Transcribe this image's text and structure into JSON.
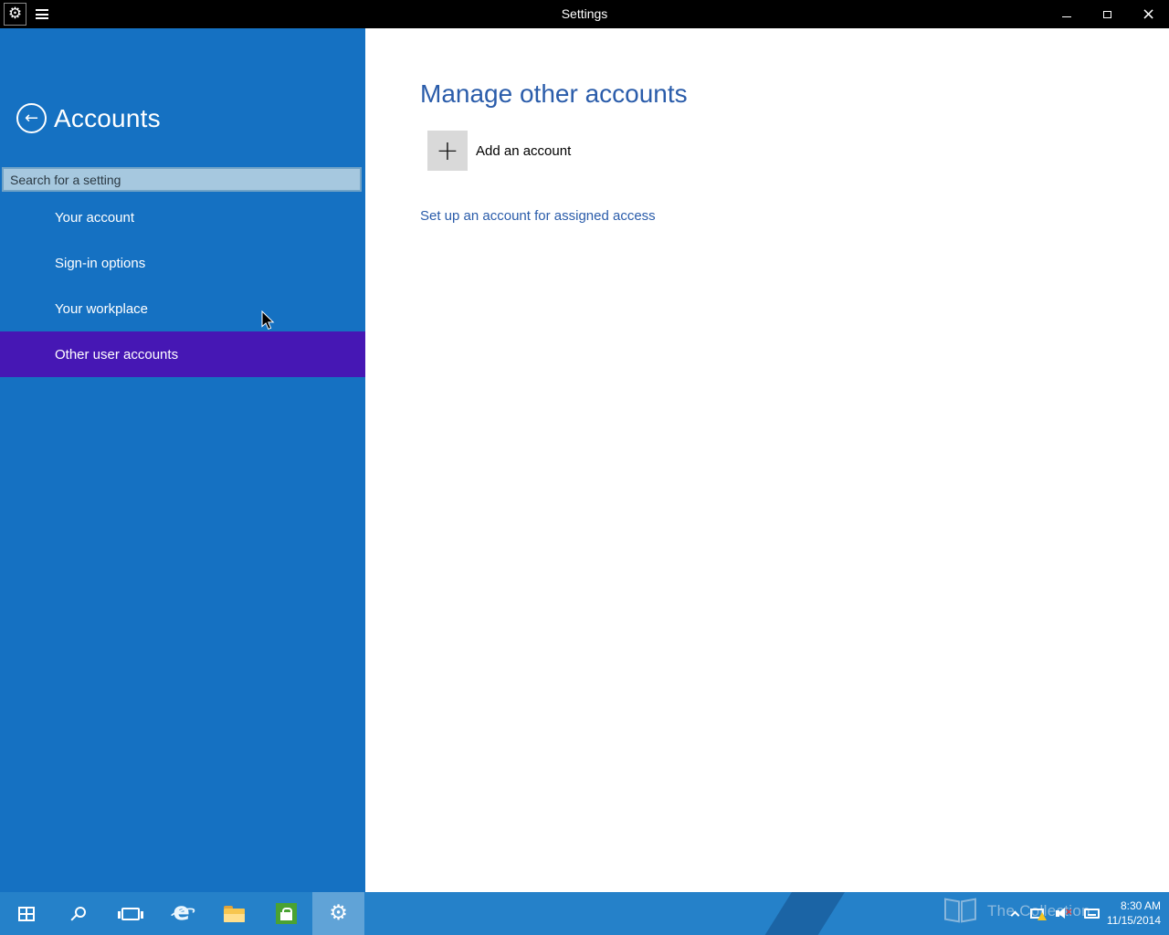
{
  "titlebar": {
    "title": "Settings"
  },
  "sidebar": {
    "title": "Accounts",
    "search_placeholder": "Search for a setting",
    "items": [
      {
        "label": "Your account",
        "selected": false
      },
      {
        "label": "Sign-in options",
        "selected": false
      },
      {
        "label": "Your workplace",
        "selected": false
      },
      {
        "label": "Other user accounts",
        "selected": true
      }
    ]
  },
  "main": {
    "title": "Manage other accounts",
    "add_label": "Add an account",
    "assigned_access_link": "Set up an account for assigned access"
  },
  "taskbar": {
    "watermark": "The Collection",
    "time": "8:30 AM",
    "date": "11/15/2014",
    "buttons": [
      "start",
      "search",
      "task-view",
      "internet-explorer",
      "file-explorer",
      "store",
      "settings"
    ],
    "active_button": "settings"
  },
  "icons": {
    "gear": "⚙",
    "back_arrow": "←",
    "add_plus": "+",
    "close": "×",
    "ie_letter": "e",
    "mute_x": "×"
  },
  "colors": {
    "titlebar": "#000000",
    "sidebar_blue": "#1571c2",
    "selected_purple": "#4617b4",
    "search_fill": "#a6c8df",
    "heading_blue": "#2a5caa",
    "taskbar_blue": "#2581c9",
    "store_green": "#4aa233",
    "folder_yellow": "#f7c64f",
    "warning_yellow": "#f5c51d"
  }
}
